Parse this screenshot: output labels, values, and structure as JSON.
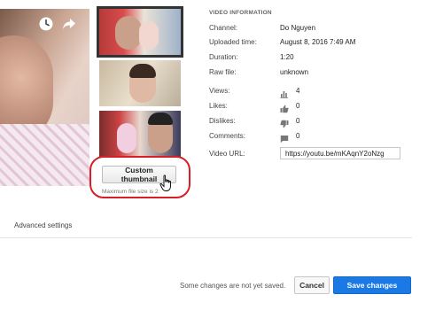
{
  "player": {
    "icons": [
      "clock-icon",
      "share-icon"
    ]
  },
  "thumbnails": {
    "custom_button_label": "Custom thumbnail",
    "max_size_note": "Maximum file size is 2 ",
    "highlight_color": "#d61f26"
  },
  "video_info": {
    "title": "VIDEO INFORMATION",
    "channel_label": "Channel:",
    "channel": "Do Nguyen",
    "uploaded_label": "Uploaded time:",
    "uploaded": "August 8, 2016 7:49 AM",
    "duration_label": "Duration:",
    "duration": "1:20",
    "raw_file_label": "Raw file:",
    "raw_file": "unknown",
    "views_label": "Views:",
    "views": "4",
    "likes_label": "Likes:",
    "likes": "0",
    "dislikes_label": "Dislikes:",
    "dislikes": "0",
    "comments_label": "Comments:",
    "comments": "0",
    "url_label": "Video URL:",
    "url": "https://youtu.be/mKAqnY2oNzg"
  },
  "advanced_settings": "Advanced settings",
  "footer": {
    "unsaved_message": "Some changes are not yet saved.",
    "cancel_label": "Cancel",
    "save_label": "Save changes",
    "save_color": "#1b79e6"
  }
}
